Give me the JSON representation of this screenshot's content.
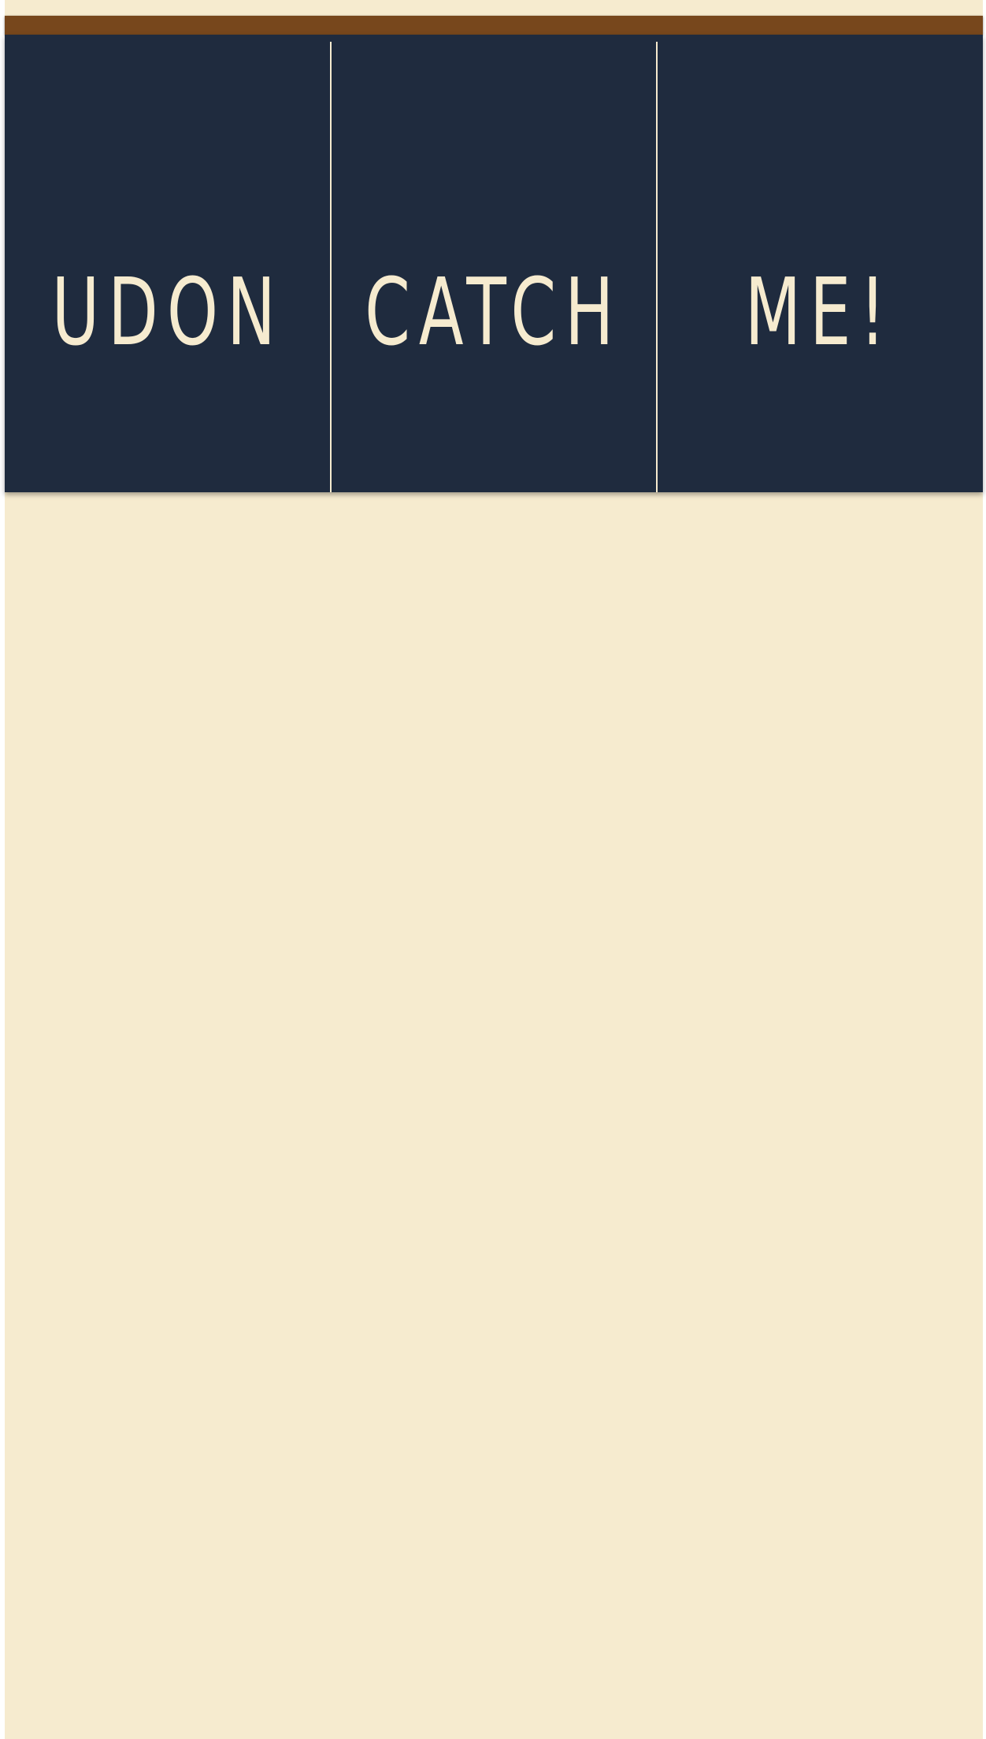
{
  "title": {
    "words": [
      "Udon",
      "Catch",
      "Me!"
    ]
  },
  "colors": {
    "background": "#f6ebcf",
    "top_bar": "#77471c",
    "board": "#1f2b3e",
    "text": "#f6ebcf"
  }
}
